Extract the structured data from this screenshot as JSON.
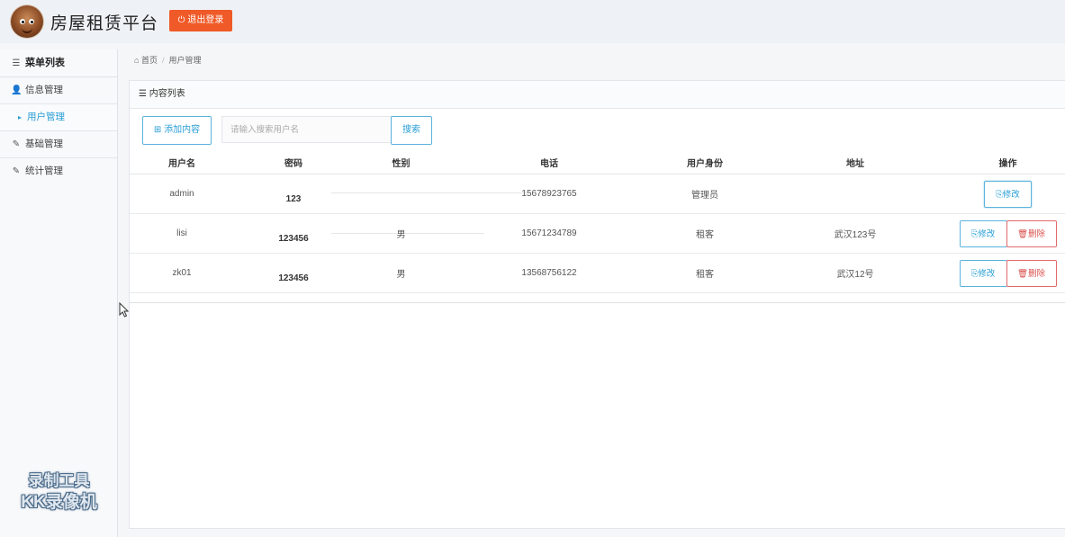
{
  "header": {
    "app_title": "房屋租赁平台",
    "logout_label": "退出登录",
    "logout_icon": "power-icon"
  },
  "sidebar": {
    "title": "菜单列表",
    "items": [
      {
        "label": "信息管理",
        "icon": "user-icon"
      },
      {
        "label": "用户管理",
        "icon": "caret-right-icon"
      },
      {
        "label": "基础管理",
        "icon": "edit-icon"
      },
      {
        "label": "统计管理",
        "icon": "edit-icon"
      }
    ]
  },
  "breadcrumb": {
    "home": "首页",
    "current": "用户管理"
  },
  "panel": {
    "title": "内容列表",
    "add_label": "添加内容",
    "search_placeholder": "请输入搜索用户名",
    "search_label": "搜索"
  },
  "table": {
    "columns": [
      "用户名",
      "密码",
      "性别",
      "电话",
      "用户身份",
      "地址",
      "操作"
    ],
    "rows": [
      {
        "username": "admin",
        "password": "123",
        "gender": "",
        "phone": "15678923765",
        "role": "管理员",
        "address": ""
      },
      {
        "username": "lisi",
        "password": "123456",
        "gender": "男",
        "phone": "15671234789",
        "role": "租客",
        "address": "武汉123号"
      },
      {
        "username": "zk01",
        "password": "123456",
        "gender": "男",
        "phone": "13568756122",
        "role": "租客",
        "address": "武汉12号"
      }
    ],
    "edit_label": "修改",
    "delete_label": "删除"
  },
  "watermark": {
    "line1": "录制工具",
    "line2": "KK录像机"
  },
  "colors": {
    "accent": "#2a9fd6",
    "danger": "#d9534f",
    "logout": "#f05a28"
  }
}
